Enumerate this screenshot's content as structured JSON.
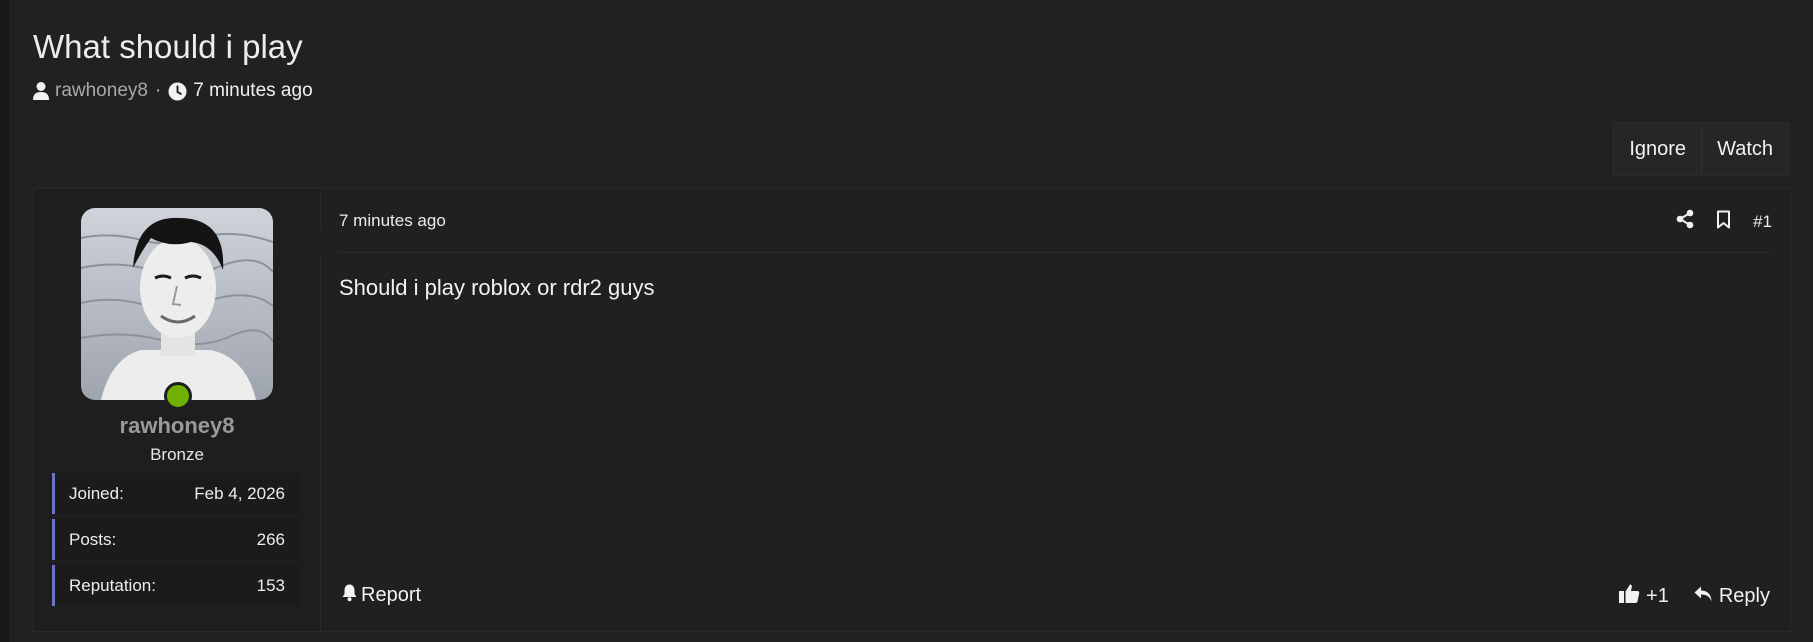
{
  "thread": {
    "title": "What should i play",
    "author": "rawhoney8",
    "separator": "·",
    "time_ago": "7 minutes ago"
  },
  "actions": {
    "ignore_label": "Ignore",
    "watch_label": "Watch"
  },
  "post": {
    "time_ago": "7 minutes ago",
    "number": "#1",
    "body": "Should i play roblox or rdr2 guys",
    "report_label": "Report",
    "like_count": "+1",
    "reply_label": "Reply"
  },
  "user": {
    "username": "rawhoney8",
    "rank": "Bronze",
    "online_status_color": "#6fb000",
    "stats": [
      {
        "label": "Joined:",
        "value": "Feb 4, 2026"
      },
      {
        "label": "Posts:",
        "value": "266"
      },
      {
        "label": "Reputation:",
        "value": "153"
      }
    ]
  },
  "icons": {
    "meta_author": "user-icon",
    "meta_time": "clock-icon",
    "share": "share-icon",
    "bookmark": "bookmark-icon",
    "report": "bell-icon",
    "like": "thumbs-up-icon",
    "reply": "reply-icon"
  },
  "colors": {
    "page_bg": "#212121",
    "stat_accent": "#6c74c4",
    "username": "#9a9a9a"
  }
}
